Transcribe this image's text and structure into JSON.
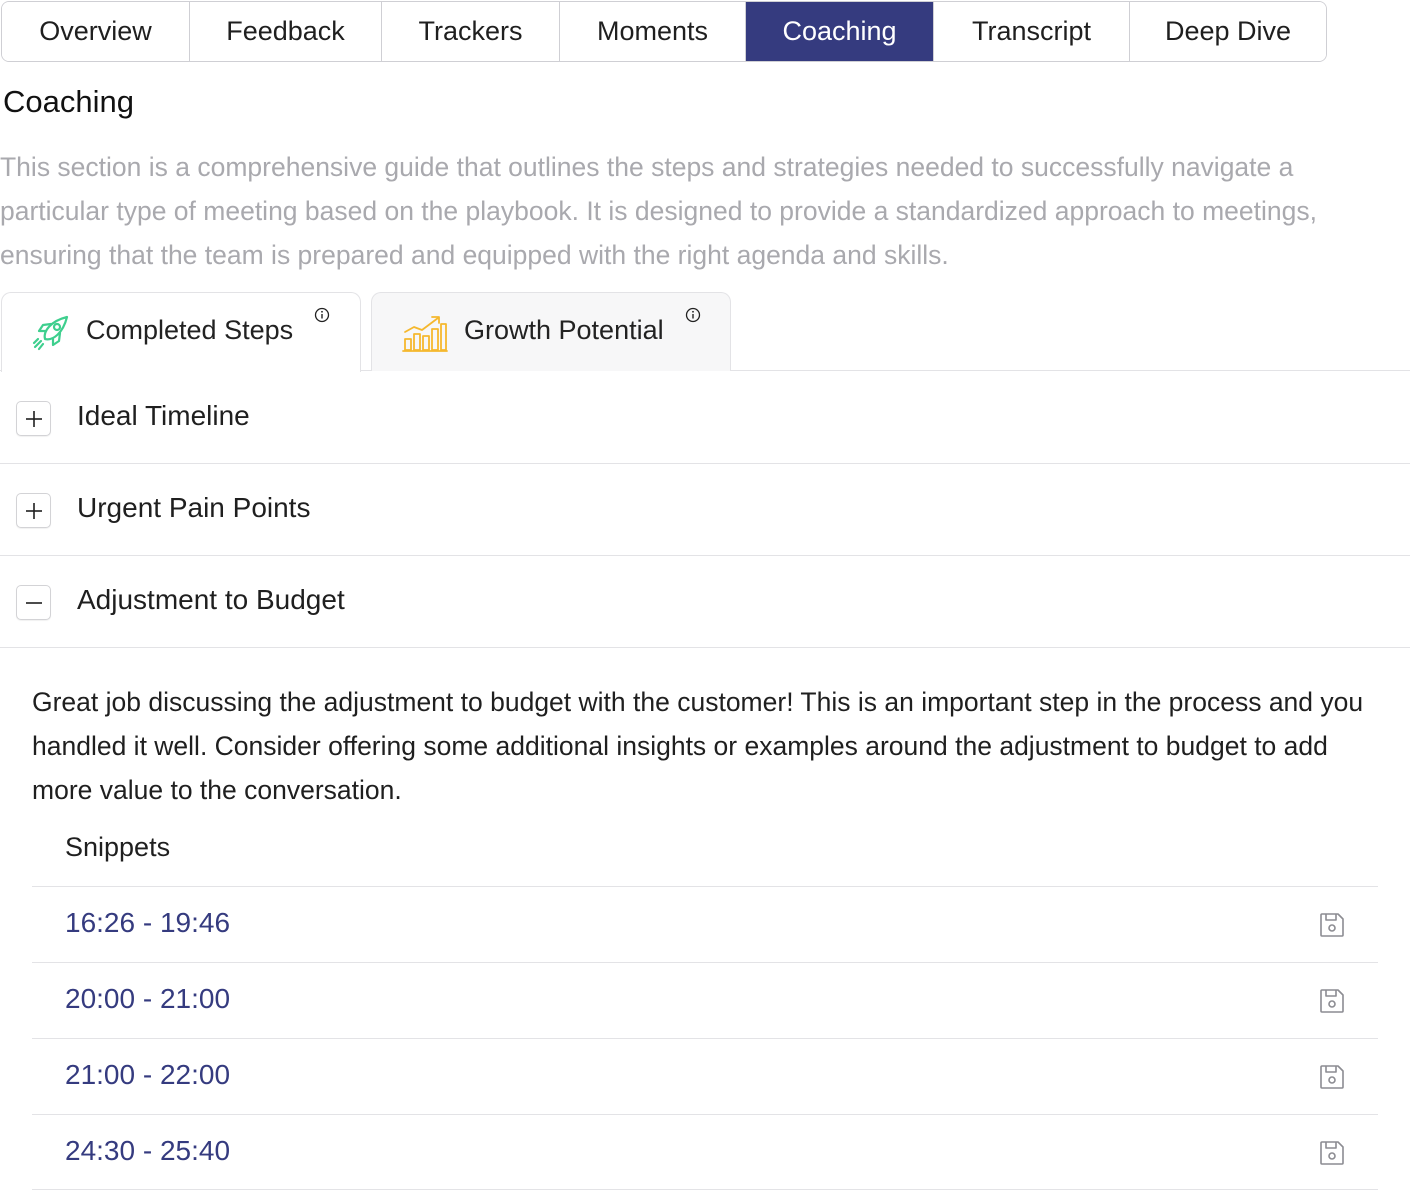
{
  "tabs": [
    {
      "label": "Overview",
      "active": false
    },
    {
      "label": "Feedback",
      "active": false
    },
    {
      "label": "Trackers",
      "active": false
    },
    {
      "label": "Moments",
      "active": false
    },
    {
      "label": "Coaching",
      "active": true
    },
    {
      "label": "Transcript",
      "active": false
    },
    {
      "label": "Deep Dive",
      "active": false
    }
  ],
  "section": {
    "title": "Coaching",
    "description": "This section is a comprehensive guide that outlines the steps and strategies needed to successfully navigate a particular type of meeting based on the playbook. It is designed to provide a standardized approach to meetings, ensuring that the team is prepared and equipped with the right agenda and skills."
  },
  "subtabs": [
    {
      "label": "Completed Steps",
      "icon": "rocket-icon",
      "active": true
    },
    {
      "label": "Growth Potential",
      "icon": "bar-chart-growth-icon",
      "active": false
    }
  ],
  "accordion": [
    {
      "title": "Ideal Timeline",
      "expanded": false
    },
    {
      "title": "Urgent Pain Points",
      "expanded": false
    },
    {
      "title": "Adjustment to Budget",
      "expanded": true,
      "body": "Great job discussing the adjustment to budget with the customer! This is an important step in the process and you handled it well. Consider offering some additional insights or examples around the adjustment to budget to add more value to the conversation.",
      "snippets_heading": "Snippets",
      "snippets": [
        "16:26 - 19:46",
        "20:00 - 21:00",
        "21:00 - 22:00",
        "24:30 - 25:40"
      ]
    }
  ],
  "colors": {
    "accent": "#353b7f",
    "muted_text": "#a9a9ae",
    "rocket": "#3ecf8e",
    "growth": "#f5b82e"
  }
}
